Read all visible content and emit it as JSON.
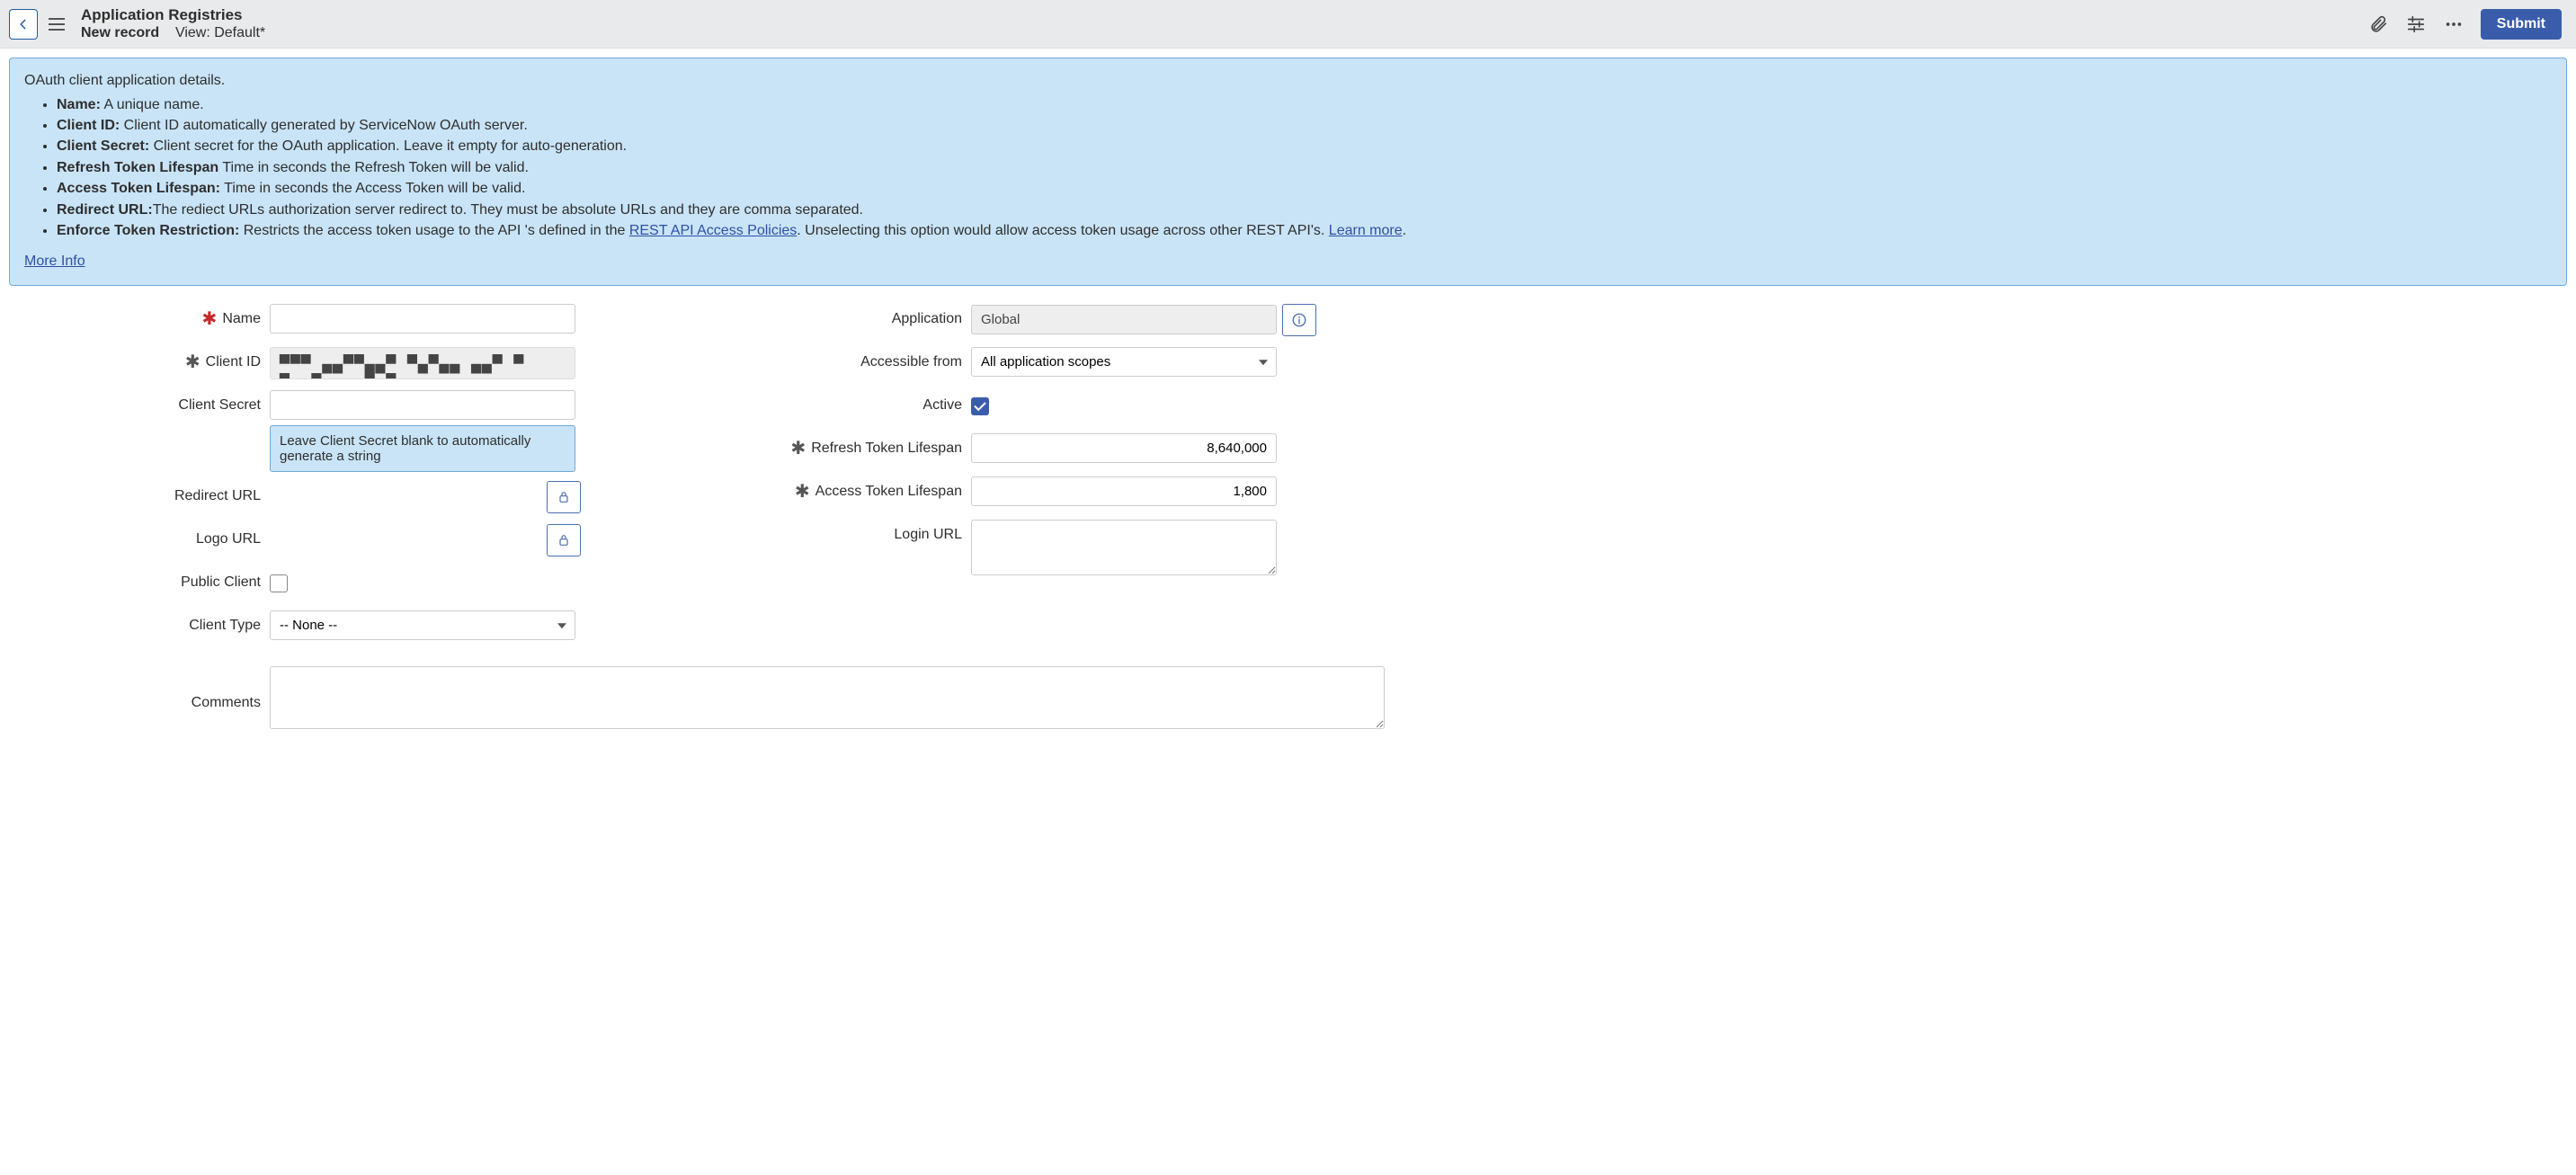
{
  "header": {
    "title": "Application Registries",
    "subtitle_record": "New record",
    "subtitle_view": "View: Default*",
    "submit_label": "Submit"
  },
  "info": {
    "intro": "OAuth client application details.",
    "items": [
      {
        "label": "Name:",
        "text": " A unique name."
      },
      {
        "label": "Client ID:",
        "text": " Client ID automatically generated by ServiceNow OAuth server."
      },
      {
        "label": "Client Secret:",
        "text": " Client secret for the OAuth application. Leave it empty for auto-generation."
      },
      {
        "label": "Refresh Token Lifespan",
        "text": " Time in seconds the Refresh Token will be valid."
      },
      {
        "label": "Access Token Lifespan:",
        "text": " Time in seconds the Access Token will be valid."
      },
      {
        "label": "Redirect URL:",
        "text": "The rediect URLs authorization server redirect to. They must be absolute URLs and they are comma separated."
      }
    ],
    "enforce_label": "Enforce Token Restriction:",
    "enforce_pre": " Restricts the access token usage to the API 's defined in the ",
    "enforce_link": "REST API Access Policies",
    "enforce_post": ". Unselecting this option would allow access token usage across other REST API's. ",
    "learn_more": "Learn more",
    "learn_more_post": ".",
    "more_info": "More Info"
  },
  "form": {
    "name_label": "Name",
    "name_value": "",
    "client_id_label": "Client ID",
    "client_id_masked": "▀▀▀ ▄▄▀▀▄▄▀ ▀▄▀▄▄ ▄▄▀  ▀ ▀▄▄▀▄▄▄▄▀ ▀ ▄▄",
    "client_secret_label": "Client Secret",
    "client_secret_value": "",
    "client_secret_help": "Leave Client Secret blank to automatically generate a string",
    "redirect_url_label": "Redirect URL",
    "logo_url_label": "Logo URL",
    "public_client_label": "Public Client",
    "public_client_checked": false,
    "client_type_label": "Client Type",
    "client_type_value": "-- None --",
    "comments_label": "Comments",
    "comments_value": "",
    "application_label": "Application",
    "application_value": "Global",
    "accessible_from_label": "Accessible from",
    "accessible_from_value": "All application scopes",
    "active_label": "Active",
    "active_checked": true,
    "refresh_token_label": "Refresh Token Lifespan",
    "refresh_token_value": "8,640,000",
    "access_token_label": "Access Token Lifespan",
    "access_token_value": "1,800",
    "login_url_label": "Login URL",
    "login_url_value": ""
  }
}
